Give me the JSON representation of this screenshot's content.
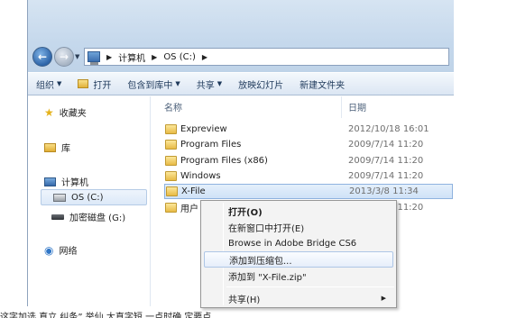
{
  "address": {
    "crumbs": [
      "计算机",
      "OS (C:)"
    ]
  },
  "toolbar": {
    "items": [
      {
        "label": "组织",
        "has_dropdown": true
      },
      {
        "label": "打开",
        "has_dropdown": false
      },
      {
        "label": "包含到库中",
        "has_dropdown": true
      },
      {
        "label": "共享",
        "has_dropdown": true
      },
      {
        "label": "放映幻灯片",
        "has_dropdown": false
      },
      {
        "label": "新建文件夹",
        "has_dropdown": false
      }
    ]
  },
  "nav": {
    "favorites": "收藏夹",
    "libraries": "库",
    "computer": "计算机",
    "drive_c": "OS (C:)",
    "drive_g": "加密磁盘 (G:)",
    "network": "网络"
  },
  "files": {
    "col_name": "名称",
    "col_date": "日期",
    "rows": [
      {
        "name": "Expreview",
        "date": "2012/10/18 16:01"
      },
      {
        "name": "Program Files",
        "date": "2009/7/14 11:20"
      },
      {
        "name": "Program Files (x86)",
        "date": "2009/7/14 11:20"
      },
      {
        "name": "Windows",
        "date": "2009/7/14 11:20"
      },
      {
        "name": "X-File",
        "date": "2013/3/8 11:34",
        "selected": true
      },
      {
        "name": "用户",
        "date": "2009/7/14 11:20"
      }
    ]
  },
  "context_menu": {
    "items": [
      {
        "label": "打开(O)",
        "bold": true
      },
      {
        "label": "在新窗口中打开(E)"
      },
      {
        "label": "Browse in Adobe Bridge CS6"
      },
      {
        "label": "添加到压缩包...",
        "hover": true
      },
      {
        "label": "添加到 \"X-File.zip\""
      },
      {
        "label": "共享(H)",
        "submenu": true
      }
    ]
  },
  "caption": "这字加选 直立 纠条” 举仙 大直字短 一点时确 定要点",
  "colors": {
    "accent": "#3569aa",
    "selection": "#cfe2f7",
    "toolbar_text": "#1e395b"
  }
}
